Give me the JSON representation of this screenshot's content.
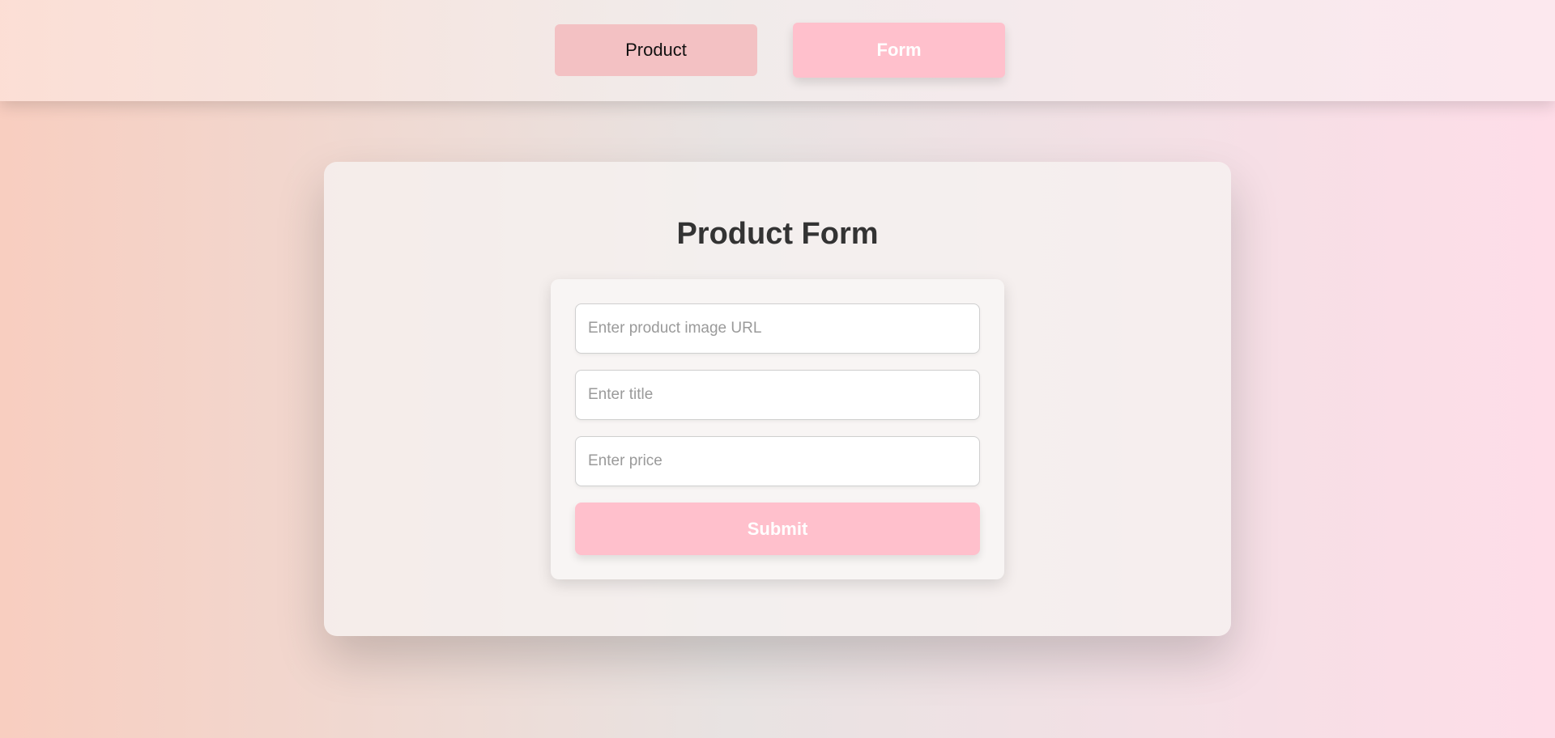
{
  "nav": {
    "product_label": "Product",
    "form_label": "Form"
  },
  "form": {
    "title": "Product Form",
    "image_url_placeholder": "Enter product image URL",
    "title_placeholder": "Enter title",
    "price_placeholder": "Enter price",
    "submit_label": "Submit"
  },
  "colors": {
    "accent_pink": "#ffc0cc",
    "product_button": "#f3c1c3",
    "heading_text": "#333333"
  }
}
